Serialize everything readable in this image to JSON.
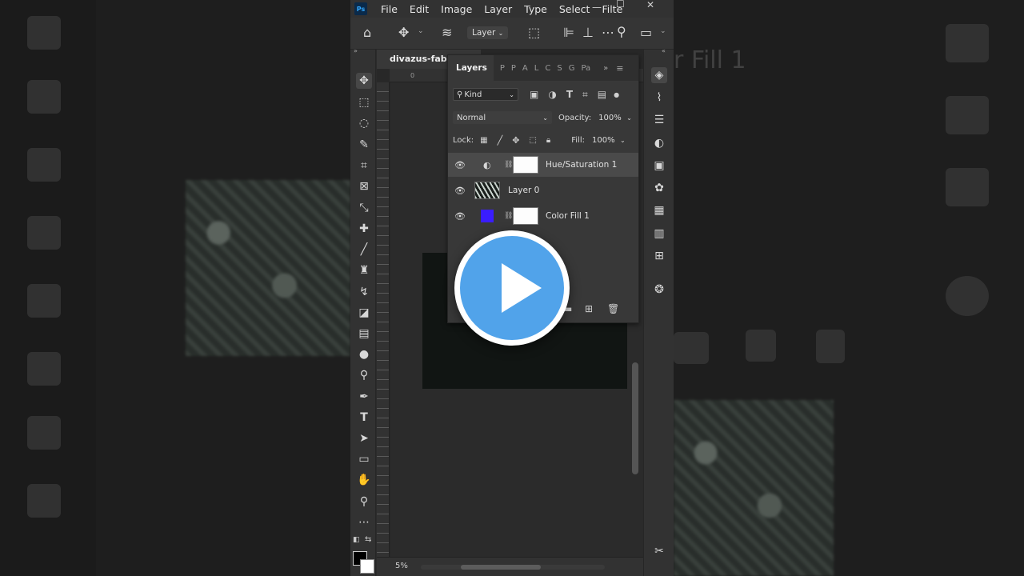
{
  "menubar": {
    "logo": "Ps",
    "items": [
      "File",
      "Edit",
      "Image",
      "Layer",
      "Type",
      "Select",
      "Filter"
    ]
  },
  "options_bar": {
    "layer_dropdown": "Layer"
  },
  "document": {
    "tab_title": "divazus-fabric",
    "ruler_origin": "0",
    "zoom": "5%"
  },
  "layers_panel": {
    "tab_active": "Layers",
    "other_tabs": [
      "P",
      "P",
      "A",
      "L",
      "C",
      "S",
      "G",
      "Pa"
    ],
    "filter_kind": "Kind",
    "blend_mode": "Normal",
    "opacity_label": "Opacity:",
    "opacity_value": "100%",
    "lock_label": "Lock:",
    "fill_label": "Fill:",
    "fill_value": "100%",
    "layers": [
      {
        "name": "Hue/Saturation 1",
        "selected": true
      },
      {
        "name": "Layer 0",
        "selected": false
      },
      {
        "name": "Color Fill 1",
        "selected": false
      }
    ]
  },
  "background": {
    "right_text": "r Fill 1"
  },
  "colors": {
    "accent_blue": "#51a3ea",
    "color_fill": "#3a1dff"
  }
}
